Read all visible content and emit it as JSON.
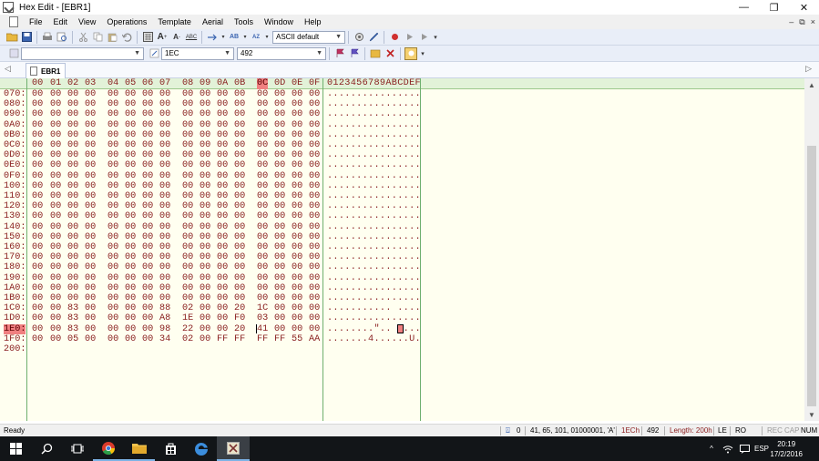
{
  "window": {
    "title": "Hex Edit - [EBR1]",
    "minimize": "—",
    "restore": "❐",
    "close": "✕"
  },
  "menu": {
    "items": [
      "File",
      "Edit",
      "View",
      "Operations",
      "Template",
      "Aerial",
      "Tools",
      "Window",
      "Help"
    ],
    "mdi_minimize": "–",
    "mdi_restore": "⧉",
    "mdi_close": "×"
  },
  "toolbar": {
    "charset_value": "ASCII default",
    "address_value": "1EC",
    "decimal_value": "492"
  },
  "tab": {
    "label": "EBR1",
    "left_arrow": "◁",
    "right_arrow": "▷"
  },
  "editor": {
    "header_hex": [
      "00",
      "01",
      "02",
      "03",
      "04",
      "05",
      "06",
      "07",
      "08",
      "09",
      "0A",
      "0B",
      "0C",
      "0D",
      "0E",
      "0F"
    ],
    "header_ascii": "0123456789ABCDEF",
    "selected_column": "0C",
    "rows": [
      {
        "offset": "070:",
        "hex": [
          "00",
          "00",
          "00",
          "00",
          "00",
          "00",
          "00",
          "00",
          "00",
          "00",
          "00",
          "00",
          "00",
          "00",
          "00",
          "00"
        ],
        "ascii": "................"
      },
      {
        "offset": "080:",
        "hex": [
          "00",
          "00",
          "00",
          "00",
          "00",
          "00",
          "00",
          "00",
          "00",
          "00",
          "00",
          "00",
          "00",
          "00",
          "00",
          "00"
        ],
        "ascii": "................"
      },
      {
        "offset": "090:",
        "hex": [
          "00",
          "00",
          "00",
          "00",
          "00",
          "00",
          "00",
          "00",
          "00",
          "00",
          "00",
          "00",
          "00",
          "00",
          "00",
          "00"
        ],
        "ascii": "................"
      },
      {
        "offset": "0A0:",
        "hex": [
          "00",
          "00",
          "00",
          "00",
          "00",
          "00",
          "00",
          "00",
          "00",
          "00",
          "00",
          "00",
          "00",
          "00",
          "00",
          "00"
        ],
        "ascii": "................"
      },
      {
        "offset": "0B0:",
        "hex": [
          "00",
          "00",
          "00",
          "00",
          "00",
          "00",
          "00",
          "00",
          "00",
          "00",
          "00",
          "00",
          "00",
          "00",
          "00",
          "00"
        ],
        "ascii": "................"
      },
      {
        "offset": "0C0:",
        "hex": [
          "00",
          "00",
          "00",
          "00",
          "00",
          "00",
          "00",
          "00",
          "00",
          "00",
          "00",
          "00",
          "00",
          "00",
          "00",
          "00"
        ],
        "ascii": "................"
      },
      {
        "offset": "0D0:",
        "hex": [
          "00",
          "00",
          "00",
          "00",
          "00",
          "00",
          "00",
          "00",
          "00",
          "00",
          "00",
          "00",
          "00",
          "00",
          "00",
          "00"
        ],
        "ascii": "................"
      },
      {
        "offset": "0E0:",
        "hex": [
          "00",
          "00",
          "00",
          "00",
          "00",
          "00",
          "00",
          "00",
          "00",
          "00",
          "00",
          "00",
          "00",
          "00",
          "00",
          "00"
        ],
        "ascii": "................"
      },
      {
        "offset": "0F0:",
        "hex": [
          "00",
          "00",
          "00",
          "00",
          "00",
          "00",
          "00",
          "00",
          "00",
          "00",
          "00",
          "00",
          "00",
          "00",
          "00",
          "00"
        ],
        "ascii": "................"
      },
      {
        "offset": "100:",
        "hex": [
          "00",
          "00",
          "00",
          "00",
          "00",
          "00",
          "00",
          "00",
          "00",
          "00",
          "00",
          "00",
          "00",
          "00",
          "00",
          "00"
        ],
        "ascii": "................"
      },
      {
        "offset": "110:",
        "hex": [
          "00",
          "00",
          "00",
          "00",
          "00",
          "00",
          "00",
          "00",
          "00",
          "00",
          "00",
          "00",
          "00",
          "00",
          "00",
          "00"
        ],
        "ascii": "................"
      },
      {
        "offset": "120:",
        "hex": [
          "00",
          "00",
          "00",
          "00",
          "00",
          "00",
          "00",
          "00",
          "00",
          "00",
          "00",
          "00",
          "00",
          "00",
          "00",
          "00"
        ],
        "ascii": "................"
      },
      {
        "offset": "130:",
        "hex": [
          "00",
          "00",
          "00",
          "00",
          "00",
          "00",
          "00",
          "00",
          "00",
          "00",
          "00",
          "00",
          "00",
          "00",
          "00",
          "00"
        ],
        "ascii": "................"
      },
      {
        "offset": "140:",
        "hex": [
          "00",
          "00",
          "00",
          "00",
          "00",
          "00",
          "00",
          "00",
          "00",
          "00",
          "00",
          "00",
          "00",
          "00",
          "00",
          "00"
        ],
        "ascii": "................"
      },
      {
        "offset": "150:",
        "hex": [
          "00",
          "00",
          "00",
          "00",
          "00",
          "00",
          "00",
          "00",
          "00",
          "00",
          "00",
          "00",
          "00",
          "00",
          "00",
          "00"
        ],
        "ascii": "................"
      },
      {
        "offset": "160:",
        "hex": [
          "00",
          "00",
          "00",
          "00",
          "00",
          "00",
          "00",
          "00",
          "00",
          "00",
          "00",
          "00",
          "00",
          "00",
          "00",
          "00"
        ],
        "ascii": "................"
      },
      {
        "offset": "170:",
        "hex": [
          "00",
          "00",
          "00",
          "00",
          "00",
          "00",
          "00",
          "00",
          "00",
          "00",
          "00",
          "00",
          "00",
          "00",
          "00",
          "00"
        ],
        "ascii": "................"
      },
      {
        "offset": "180:",
        "hex": [
          "00",
          "00",
          "00",
          "00",
          "00",
          "00",
          "00",
          "00",
          "00",
          "00",
          "00",
          "00",
          "00",
          "00",
          "00",
          "00"
        ],
        "ascii": "................"
      },
      {
        "offset": "190:",
        "hex": [
          "00",
          "00",
          "00",
          "00",
          "00",
          "00",
          "00",
          "00",
          "00",
          "00",
          "00",
          "00",
          "00",
          "00",
          "00",
          "00"
        ],
        "ascii": "................"
      },
      {
        "offset": "1A0:",
        "hex": [
          "00",
          "00",
          "00",
          "00",
          "00",
          "00",
          "00",
          "00",
          "00",
          "00",
          "00",
          "00",
          "00",
          "00",
          "00",
          "00"
        ],
        "ascii": "................"
      },
      {
        "offset": "1B0:",
        "hex": [
          "00",
          "00",
          "00",
          "00",
          "00",
          "00",
          "00",
          "00",
          "00",
          "00",
          "00",
          "00",
          "00",
          "00",
          "00",
          "00"
        ],
        "ascii": "................"
      },
      {
        "offset": "1C0:",
        "hex": [
          "00",
          "00",
          "83",
          "00",
          "00",
          "00",
          "00",
          "88",
          "02",
          "00",
          "00",
          "20",
          "1C",
          "00",
          "00",
          "00"
        ],
        "ascii": "........... ...."
      },
      {
        "offset": "1D0:",
        "hex": [
          "00",
          "00",
          "83",
          "00",
          "00",
          "00",
          "00",
          "A8",
          "1E",
          "00",
          "00",
          "F0",
          "03",
          "00",
          "00",
          "00"
        ],
        "ascii": "................"
      },
      {
        "offset": "1E0:",
        "hex": [
          "00",
          "00",
          "83",
          "00",
          "00",
          "00",
          "00",
          "98",
          "22",
          "00",
          "00",
          "20",
          "41",
          "00",
          "00",
          "00"
        ],
        "ascii": "........\".. A..."
      },
      {
        "offset": "1F0:",
        "hex": [
          "00",
          "00",
          "05",
          "00",
          "00",
          "00",
          "00",
          "34",
          "02",
          "00",
          "FF",
          "FF",
          "FF",
          "FF",
          "55",
          "AA"
        ],
        "ascii": ".......4......U."
      },
      {
        "offset": "200:",
        "hex": [],
        "ascii": ""
      }
    ],
    "selected_row_offset": "1E0:"
  },
  "status": {
    "ready": "Ready",
    "cursor_char": "0",
    "value_info": "41, 65, 101, 01000001, 'A'",
    "hex_address": "1ECh",
    "dec_address": "492",
    "length": "Length: 200h",
    "endian": "LE",
    "ro": "RO",
    "rec": "REC",
    "cap": "CAP",
    "num": "NUM"
  },
  "taskbar": {
    "language": "ESP",
    "time": "20:19",
    "date": "17/2/2016"
  }
}
